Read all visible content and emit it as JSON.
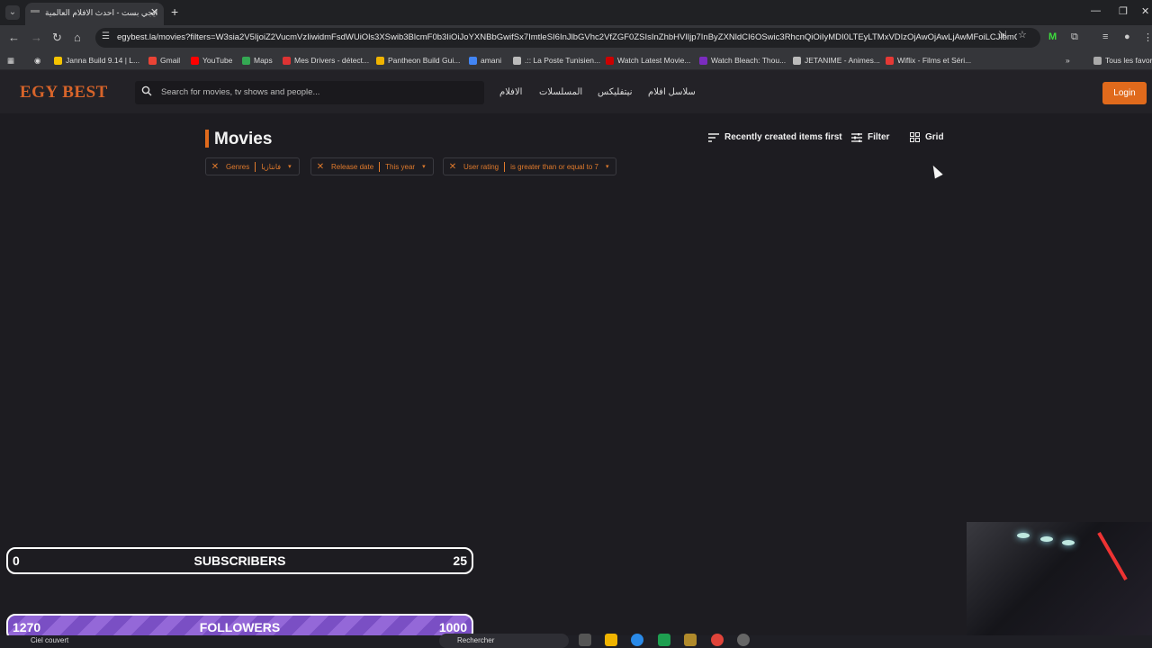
{
  "browser": {
    "tab_title": "ايجي بست - احدث الافلام العالمية",
    "url": "egybest.la/movies?filters=W3sia2V5IjoiZ2VucmVzIiwidmFsdWUiOls3XSwib3BlcmF0b3IiOiJoYXNBbGwifSx7ImtleSI6InJlbGVhc2VfZGF0ZSIsInZhbHVlIjp7InByZXNldCI6OSwic3RhcnQiOiIyMDI0LTEyLTMxVDIzOjAwOjAwLjAwMFoiLCJlbmQi...",
    "bookmarks": [
      {
        "label": "Janna Build 9.14 | L...",
        "color": "#f5c400"
      },
      {
        "label": "Gmail",
        "color": "#ea4335"
      },
      {
        "label": "YouTube",
        "color": "#ff0000"
      },
      {
        "label": "Maps",
        "color": "#34a853"
      },
      {
        "label": "Mes Drivers - détect...",
        "color": "#d33"
      },
      {
        "label": "Pantheon Build Gui...",
        "color": "#f0b400"
      },
      {
        "label": "amani",
        "color": "#4285f4"
      },
      {
        "label": ".:: La Poste Tunisien...",
        "color": "#bbb"
      },
      {
        "label": "Watch Latest Movie...",
        "color": "#c00"
      },
      {
        "label": "Watch Bleach: Thou...",
        "color": "#7b2cbf"
      },
      {
        "label": "JETANIME - Animes...",
        "color": "#bbb"
      },
      {
        "label": "Wiflix - Films et Séri...",
        "color": "#e53935"
      }
    ],
    "all_favorites": "Tous les favoris"
  },
  "site": {
    "logo_main": "EGY",
    "logo_accent": "BEST",
    "search_placeholder": "Search for movies, tv shows and people...",
    "nav": [
      "الافلام",
      "المسلسلات",
      "نيتفليكس",
      "سلاسل افلام"
    ],
    "login": "Login"
  },
  "page": {
    "title": "Movies",
    "sort": "Recently created items first",
    "filter": "Filter",
    "view": "Grid",
    "chips": [
      {
        "label": "Genres",
        "value": "فانتازيا"
      },
      {
        "label": "Release date",
        "value": "This year"
      },
      {
        "label": "User rating",
        "value": "is greater than or equal to 7"
      }
    ]
  },
  "overlay": {
    "subs_left": "0",
    "subs_label": "SUBSCRIBERS",
    "subs_right": "25",
    "fol_left": "1270",
    "fol_label": "FOLLOWERS",
    "fol_right": "1000"
  },
  "taskbar": {
    "weather": "Ciel couvert",
    "search": "Rechercher"
  },
  "colors": {
    "accent": "#e06a1c",
    "followers": "#7a4fc4"
  }
}
